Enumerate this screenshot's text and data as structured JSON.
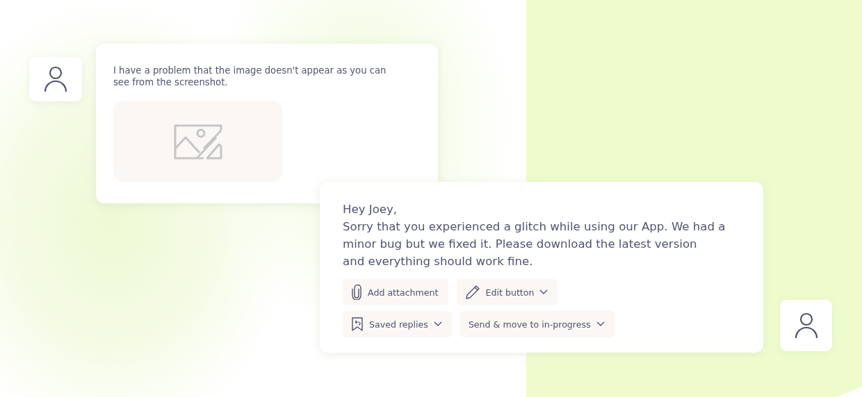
{
  "customer_message": {
    "text": "I have a problem that the image doesn't appear as you can\nsee from the screenshot.",
    "attachment": {
      "kind": "image-placeholder"
    }
  },
  "agent_reply": {
    "greeting": "Hey Joey,",
    "body": "Sorry that you experienced a glitch while using our App. We had a\nminor bug but we fixed it. Please download the latest version\nand everything should work fine.",
    "actions": [
      [
        {
          "label": "Add attachment",
          "kind": "attachment",
          "dropdown": false
        },
        {
          "label": "Edit button",
          "kind": "edit",
          "dropdown": true
        }
      ],
      [
        {
          "label": "Saved replies",
          "kind": "saved",
          "dropdown": true
        },
        {
          "label": "Send & move to in-progress",
          "kind": "send",
          "dropdown": true
        }
      ]
    ]
  }
}
